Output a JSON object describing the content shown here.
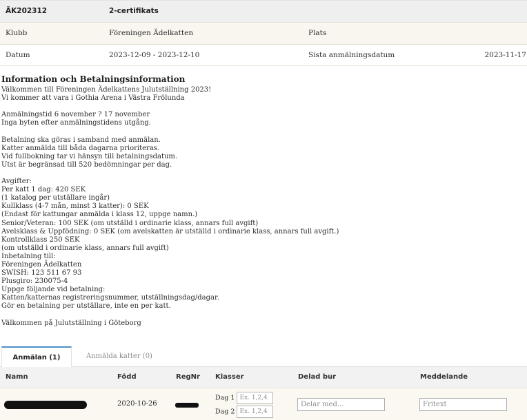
{
  "show": {
    "code": "ÄK202312",
    "certificate": "2-certifikats",
    "club_label": "Klubb",
    "club_value": "Föreningen Ädelkatten",
    "place_label": "Plats",
    "date_label": "Datum",
    "date_value": "2023-12-09 - 2023-12-10",
    "deadline_label": "Sista anmälningsdatum",
    "deadline_value": "2023-11-17"
  },
  "info": {
    "title": "Information och Betalningsinformation",
    "lines": [
      "Välkommen till Föreningen Ädelkattens Julutställning 2023!",
      "Vi kommer att vara i Gothia Arena i Västra Frölunda",
      "",
      "Anmälningstid 6 november ? 17 november",
      "Inga byten efter anmälningstidens utgång.",
      "",
      "Betalning ska göras i samband med anmälan.",
      "Katter anmälda till båda dagarna prioriteras.",
      "Vid fullbokning tar vi hänsyn till betalningsdatum.",
      "Utst är begränsad till 520 bedömningar per dag.",
      "",
      "Avgifter:",
      "Per katt 1 dag: 420 SEK",
      "(1 katalog per utställare ingår)",
      "Kullklass (4-7 mån, minst 3 katter): 0 SEK",
      "(Endast för kattungar anmälda i klass 12, uppge namn.)",
      "Senior/Veteran: 100 SEK (om utställd i ordinarie klass, annars full avgift)",
      "Avelsklass & Uppfödning: 0 SEK (om avelskatten är utställd i ordinarie klass, annars full avgift.)",
      "Kontrollklass 250 SEK",
      "(om utställd i ordinarie klass, annars full avgift)",
      "Inbetalning till:",
      "Föreningen Ädelkatten",
      "SWISH: 123 511 67 93",
      "Plusgiro: 230075-4",
      "Uppge följande vid betalning:",
      "Katten/katternas registreringsnummer, utställningsdag/dagar.",
      "Gör en betalning per utställare, inte en per katt.",
      "",
      "Välkommen på Julutställning i Göteborg"
    ]
  },
  "tabs": {
    "registration": "Anmälan (1)",
    "registered_cats": "Anmälda katter (0)"
  },
  "registration_table": {
    "headers": {
      "name": "Namn",
      "born": "Född",
      "regnr": "RegNr",
      "classes": "Klasser",
      "shared_cage": "Delad bur",
      "message": "Meddelande"
    },
    "row": {
      "born": "2020-10-26",
      "day1_label": "Dag 1",
      "day2_label": "Dag 2",
      "class_placeholder": "Ex. 1,2,4",
      "shared_cage_placeholder": "Delar med...",
      "message_placeholder": "Fritext"
    }
  },
  "colors": {
    "active_tab_accent": "#4b90c8",
    "header_bg": "#efefef",
    "row_bg": "#f9f6ef"
  }
}
